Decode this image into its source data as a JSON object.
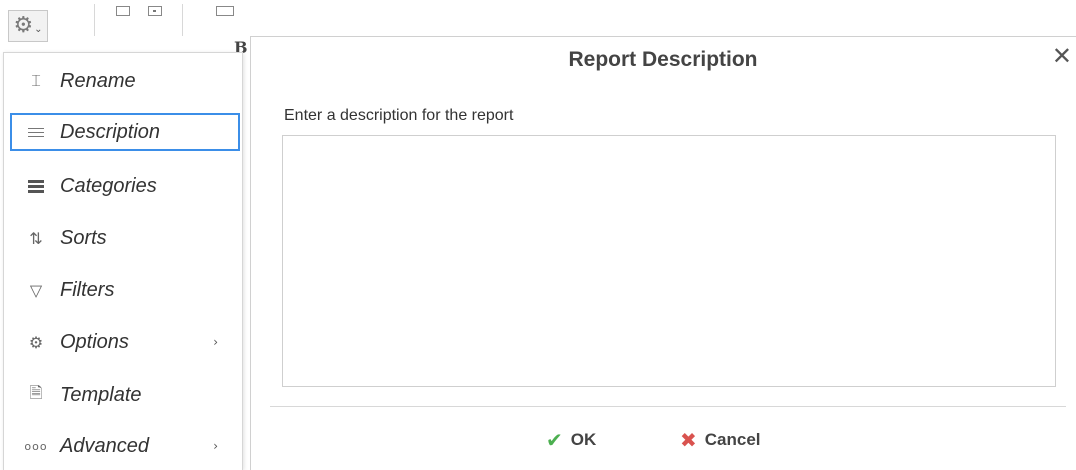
{
  "toolbar": {
    "gear_glyph": "⚙",
    "chevron_glyph": "⌄",
    "fragment_text": "B"
  },
  "menu": {
    "items": [
      {
        "label": "Rename",
        "icon": "rename-icon",
        "glyph": "⌶",
        "has_submenu": false,
        "active": false
      },
      {
        "label": "Description",
        "icon": "description-lines-icon",
        "glyph": "",
        "has_submenu": false,
        "active": true
      },
      {
        "label": "Categories",
        "icon": "categories-bars-icon",
        "glyph": "",
        "has_submenu": false,
        "active": false
      },
      {
        "label": "Sorts",
        "icon": "sort-az-icon",
        "glyph": "⇅",
        "has_submenu": false,
        "active": false
      },
      {
        "label": "Filters",
        "icon": "filter-funnel-icon",
        "glyph": "▽",
        "has_submenu": false,
        "active": false
      },
      {
        "label": "Options",
        "icon": "options-gear-icon",
        "glyph": "⚙",
        "has_submenu": true,
        "active": false
      },
      {
        "label": "Template",
        "icon": "template-doc-icon",
        "glyph": "🗎",
        "has_submenu": false,
        "active": false
      },
      {
        "label": "Advanced",
        "icon": "advanced-dots-icon",
        "glyph": "ooo",
        "has_submenu": true,
        "active": false
      }
    ],
    "submenu_arrow": "›",
    "active_border_color": "#3b8ee8"
  },
  "dialog": {
    "title": "Report Description",
    "close_glyph": "✕",
    "prompt": "Enter a description for the report",
    "description_value": "",
    "ok_label": "OK",
    "ok_glyph": "✔",
    "ok_color": "#4caf50",
    "cancel_label": "Cancel",
    "cancel_glyph": "✖",
    "cancel_color": "#d9534f"
  }
}
